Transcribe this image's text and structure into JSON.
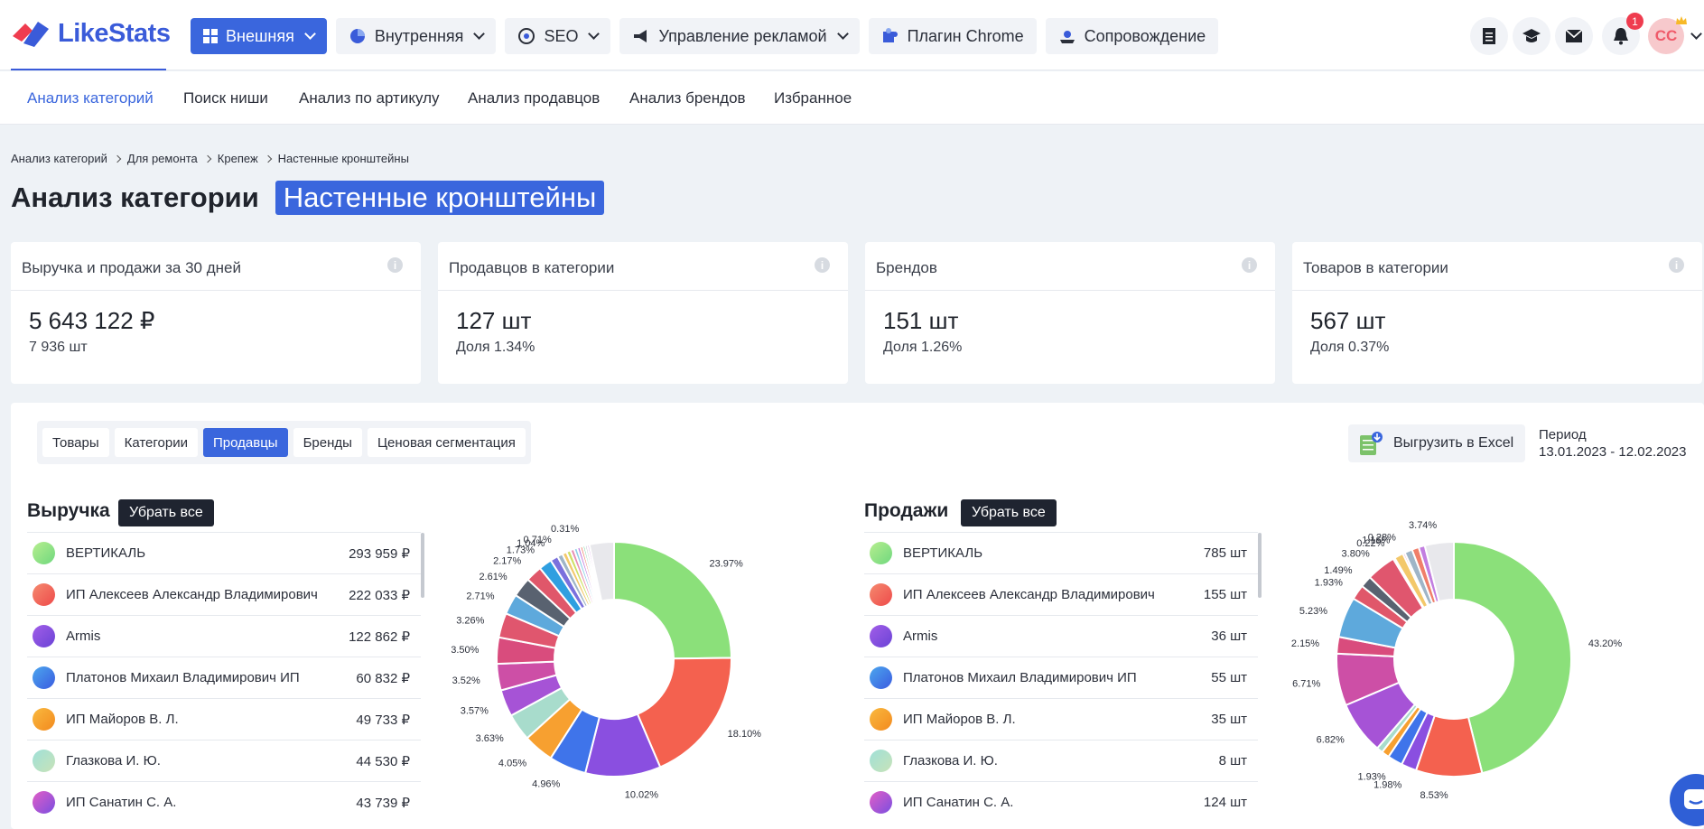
{
  "header": {
    "logo_text": "LikeStats",
    "nav": [
      {
        "label": "Внешняя",
        "icon": "grid-icon",
        "active": true,
        "dropdown": true
      },
      {
        "label": "Внутренняя",
        "icon": "pie-icon",
        "active": false,
        "dropdown": true
      },
      {
        "label": "SEO",
        "icon": "seo-icon",
        "active": false,
        "dropdown": true
      },
      {
        "label": "Управление рекламой",
        "icon": "megaphone-icon",
        "active": false,
        "dropdown": true
      },
      {
        "label": "Плагин Chrome",
        "icon": "puzzle-icon",
        "active": false,
        "dropdown": false
      },
      {
        "label": "Сопровождение",
        "icon": "support-icon",
        "active": false,
        "dropdown": false
      }
    ],
    "notifications_count": "1",
    "avatar_initials": "CC"
  },
  "subnav": [
    "Анализ категорий",
    "Поиск ниши",
    "Анализ по артикулу",
    "Анализ продавцов",
    "Анализ брендов",
    "Избранное"
  ],
  "breadcrumb": [
    "Анализ категорий",
    "Для ремонта",
    "Крепеж",
    "Настенные кронштейны"
  ],
  "page": {
    "title": "Анализ категории",
    "category": "Настенные кронштейны"
  },
  "cards": [
    {
      "title": "Выручка и продажи за 30 дней",
      "value": "5 643 122 ₽",
      "sub": "7 936 шт"
    },
    {
      "title": "Продавцов в категории",
      "value": "127 шт",
      "sub": "Доля 1.34%"
    },
    {
      "title": "Брендов",
      "value": "151 шт",
      "sub": "Доля 1.26%"
    },
    {
      "title": "Товаров в категории",
      "value": "567 шт",
      "sub": "Доля 0.37%"
    }
  ],
  "tabs": [
    {
      "label": "Товары",
      "active": false
    },
    {
      "label": "Категории",
      "active": false
    },
    {
      "label": "Продавцы",
      "active": true
    },
    {
      "label": "Бренды",
      "active": false
    },
    {
      "label": "Ценовая сегментация",
      "active": false
    }
  ],
  "export_label": "Выгрузить в Excel",
  "period": {
    "label": "Период",
    "value": "13.01.2023 - 12.02.2023"
  },
  "clear_label": "Убрать все",
  "revenue": {
    "title": "Выручка",
    "rows": [
      {
        "name": "ВЕРТИКАЛЬ",
        "value": "293 959 ₽"
      },
      {
        "name": "ИП Алексеев Александр Владимирович",
        "value": "222 033 ₽"
      },
      {
        "name": "Armis",
        "value": "122 862 ₽"
      },
      {
        "name": "Платонов Михаил Владимирович ИП",
        "value": "60 832 ₽"
      },
      {
        "name": "ИП Майоров В. Л.",
        "value": "49 733 ₽"
      },
      {
        "name": "Глазкова И. Ю.",
        "value": "44 530 ₽"
      },
      {
        "name": "ИП Санатин С. А.",
        "value": "43 739 ₽"
      }
    ]
  },
  "sales": {
    "title": "Продажи",
    "rows": [
      {
        "name": "ВЕРТИКАЛЬ",
        "value": "785 шт"
      },
      {
        "name": "ИП Алексеев Александр Владимирович",
        "value": "155 шт"
      },
      {
        "name": "Armis",
        "value": "36 шт"
      },
      {
        "name": "Платонов Михаил Владимирович ИП",
        "value": "55 шт"
      },
      {
        "name": "ИП Майоров В. Л.",
        "value": "35 шт"
      },
      {
        "name": "Глазкова И. Ю.",
        "value": "8 шт"
      },
      {
        "name": "ИП Санатин С. А.",
        "value": "124 шт"
      }
    ]
  },
  "colors": {
    "accent": "#3a66dd",
    "palette": [
      "#8be07a",
      "#f4614f",
      "#8a4fe0",
      "#3f74ea",
      "#f7a030",
      "#a8dccc",
      "#a653d6",
      "#cd4fa6",
      "#d94c7d",
      "#e0566e",
      "#5ea9dc",
      "#596270",
      "#e0576a",
      "#2f9fe0",
      "#7a70dd",
      "#9fb5c7",
      "#f3c86a",
      "#cfe066",
      "#e88fb2",
      "#90d0e8",
      "#c27ee0",
      "#f07f6a",
      "#6ad39a",
      "#b8b8c8",
      "#d9a6e8",
      "#e8e8ec"
    ],
    "palette_sales": [
      "#8be07a",
      "#f4614f",
      "#8a4fe0",
      "#3f74ea",
      "#f7a030",
      "#a8dccc",
      "#a653d6",
      "#cd4fa6",
      "#d94c7d",
      "#5ea9dc",
      "#e0576a",
      "#596270",
      "#e0566e",
      "#7a70dd",
      "#f3c86a",
      "#e88fb2",
      "#9fb5c7",
      "#f07f6a",
      "#c27ee0",
      "#e8e8ec"
    ]
  },
  "chart_data": [
    {
      "type": "pie",
      "title": "Выручка",
      "unit": "%",
      "values": [
        23.97,
        18.1,
        10.02,
        4.96,
        4.05,
        3.63,
        3.57,
        3.52,
        3.5,
        3.26,
        2.71,
        2.61,
        2.17,
        1.73,
        1.04,
        0.71,
        0.6,
        0.55,
        0.5,
        0.45,
        0.4,
        0.35,
        0.31,
        0.3,
        0.3,
        3.26
      ],
      "labels": [
        "23.97%",
        "18.10%",
        "10.02%",
        "4.96%",
        "4.05%",
        "3.63%",
        "3.57%",
        "3.52%",
        "3.50%",
        "3.26%",
        "2.71%",
        "2.61%",
        "2.17%",
        "1.73%",
        "1.04%",
        "0.71%",
        "",
        "",
        "",
        "",
        "",
        "",
        "0.31%",
        "",
        "",
        ""
      ]
    },
    {
      "type": "pie",
      "title": "Продажи",
      "unit": "%",
      "values": [
        43.2,
        8.53,
        1.98,
        1.93,
        1.0,
        0.8,
        6.82,
        6.71,
        2.15,
        5.23,
        1.93,
        1.49,
        3.8,
        0.22,
        1.16,
        0.28,
        1.0,
        0.9,
        0.8,
        3.74
      ],
      "labels": [
        "43.20%",
        "8.53%",
        "1.98%",
        "1.93%",
        "",
        "",
        "6.82%",
        "6.71%",
        "2.15%",
        "5.23%",
        "1.93%",
        "1.49%",
        "3.80%",
        "0.22%",
        "1.16%",
        "0.28%",
        "",
        "",
        "",
        "3.74%"
      ]
    }
  ]
}
